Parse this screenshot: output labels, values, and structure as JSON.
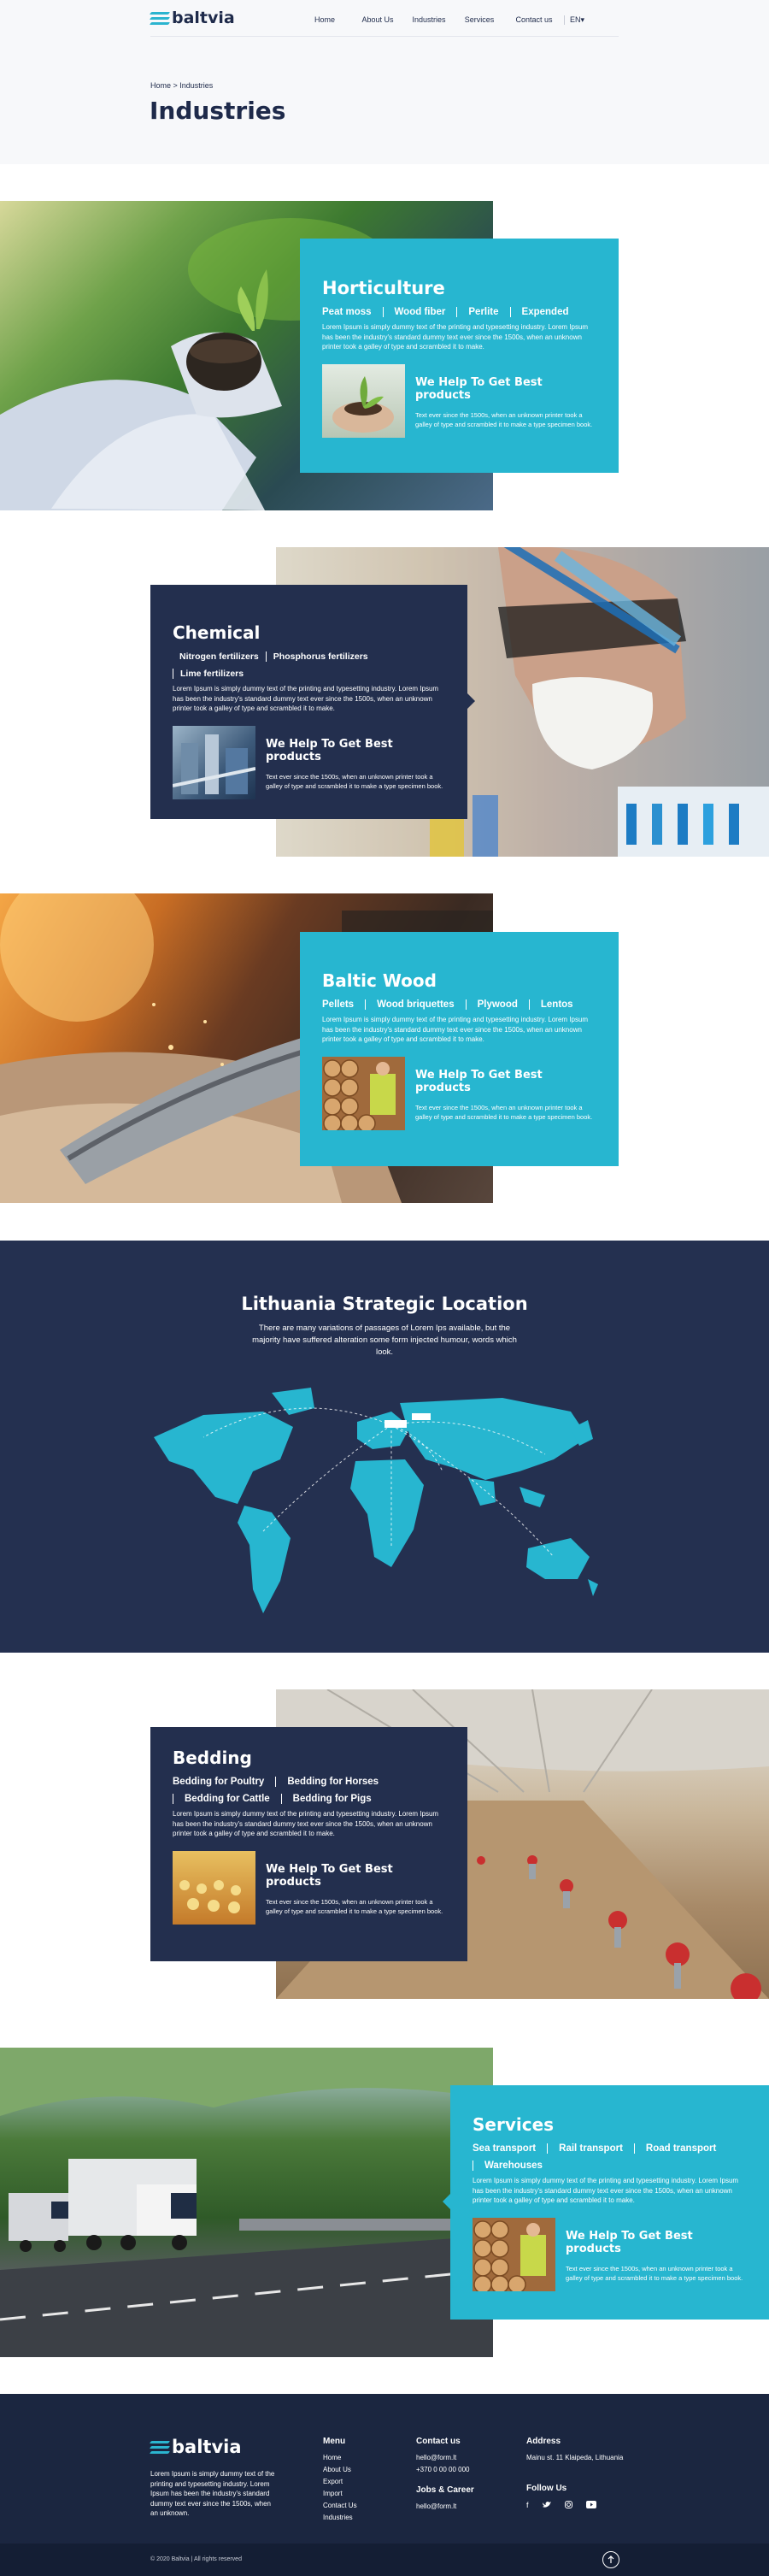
{
  "header": {
    "logo": "baltvia",
    "nav": [
      "Home",
      "About Us",
      "Industries",
      "Services",
      "Contact us"
    ],
    "lang": "EN▾"
  },
  "page": {
    "breadcrumb": "Home > Industries",
    "title": "Industries"
  },
  "industries": [
    {
      "title": "Horticulture",
      "tags": [
        "Peat moss",
        "Wood fiber",
        "Perlite",
        "Expended"
      ],
      "text": "Lorem Ipsum is simply dummy text of the printing and typesetting industry. Lorem Ipsum has been the industry's standard dummy text ever since the 1500s, when an unknown printer took a galley of type and scrambled it to make.",
      "help_title": "We Help To Get Best products",
      "help_text": "Text ever since the 1500s, when an unknown printer took a galley of type and scrambled it to make a type specimen book."
    },
    {
      "title": "Chemical",
      "tags": [
        "Nitrogen fertilizers",
        "Phosphorus fertilizers",
        "Lime fertilizers"
      ],
      "text": "Lorem Ipsum is simply dummy text of the printing and typesetting industry. Lorem Ipsum has been the industry's standard dummy text ever since the 1500s, when an unknown printer took a galley of type and scrambled it to make.",
      "help_title": "We Help To Get Best products",
      "help_text": "Text ever since the 1500s, when an unknown printer took a galley of type and scrambled it to make a type specimen book."
    },
    {
      "title": "Baltic Wood",
      "tags": [
        "Pellets",
        "Wood briquettes",
        "Plywood",
        "Lentos"
      ],
      "text": "Lorem Ipsum is simply dummy text of the printing and typesetting industry. Lorem Ipsum has been the industry's standard dummy text ever since the 1500s, when an unknown printer took a galley of type and scrambled it to make.",
      "help_title": "We Help To Get Best products",
      "help_text": "Text ever since the 1500s, when an unknown printer took a galley of type and scrambled it to make a type specimen book."
    },
    {
      "title": "Bedding",
      "tags": [
        "Bedding for Poultry",
        "Bedding for Horses",
        "Bedding for Cattle",
        "Bedding for Pigs"
      ],
      "text": "Lorem Ipsum is simply dummy text of the printing and typesetting industry. Lorem Ipsum has been the industry's standard dummy text ever since the 1500s, when an unknown printer took a galley of type and scrambled it to make.",
      "help_title": "We Help To Get Best products",
      "help_text": "Text ever since the 1500s, when an unknown printer took a galley of type and scrambled it to make a type specimen book."
    },
    {
      "title": "Services",
      "tags": [
        "Sea transport",
        "Rail transport",
        "Road transport",
        "Warehouses"
      ],
      "text": "Lorem Ipsum is simply dummy text of the printing and typesetting industry. Lorem Ipsum has been the industry's standard dummy text ever since the 1500s, when an unknown printer took a galley of type and scrambled it to make.",
      "help_title": "We Help To Get Best products",
      "help_text": "Text ever since the 1500s, when an unknown printer took a galley of type and scrambled it to make a type specimen book."
    }
  ],
  "map": {
    "title": "Lithuania Strategic Location",
    "text": "There are many variations of passages of Lorem Ips available, but the majority have suffered alteration some form injected humour, words which look."
  },
  "footer": {
    "logo": "baltvia",
    "about": "Lorem Ipsum is simply dummy text of the printing and typesetting industry. Lorem Ipsum has been the industry's standard dummy text ever since the 1500s, when an unknown.",
    "menu_title": "Menu",
    "menu": [
      "Home",
      "About Us",
      "Export",
      "Import",
      "Contact Us",
      "Industries"
    ],
    "contact_title": "Contact us",
    "email": "hello@form.lt",
    "phone": "+370 0 00 00 000",
    "jobs_title": "Jobs & Career",
    "jobs_email": "hello@form.lt",
    "address_title": "Address",
    "address": "Mainu st. 11 Klaipeda, Lithuania",
    "follow_title": "Follow Us",
    "copyright": "© 2020 Baltvia | All rights reserved"
  },
  "colors": {
    "teal": "#27b6d0",
    "navy": "#232f4e",
    "footer": "#1b2640"
  }
}
